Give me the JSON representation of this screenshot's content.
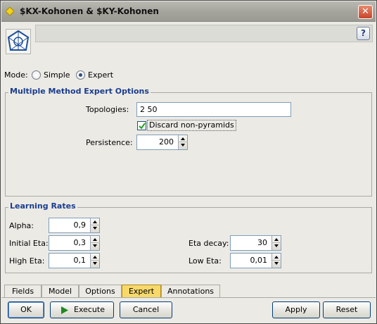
{
  "window": {
    "title": "$KX-Kohonen & $KY-Kohonen",
    "close_glyph": "✕"
  },
  "header": {
    "help_glyph": "?"
  },
  "mode": {
    "label": "Mode:",
    "options": [
      "Simple",
      "Expert"
    ],
    "selected": "Expert"
  },
  "mmeo": {
    "title": "Multiple Method Expert Options",
    "topologies_label": "Topologies:",
    "topologies_value": "2 50",
    "discard_label": "Discard non-pyramids",
    "discard_checked": true,
    "persistence_label": "Persistence:",
    "persistence_value": "200"
  },
  "learning": {
    "title": "Learning Rates",
    "alpha_label": "Alpha:",
    "alpha_value": "0,9",
    "initial_eta_label": "Initial Eta:",
    "initial_eta_value": "0,3",
    "high_eta_label": "High Eta:",
    "high_eta_value": "0,1",
    "eta_decay_label": "Eta decay:",
    "eta_decay_value": "30",
    "low_eta_label": "Low Eta:",
    "low_eta_value": "0,01"
  },
  "tabs": [
    "Fields",
    "Model",
    "Options",
    "Expert",
    "Annotations"
  ],
  "active_tab": "Expert",
  "buttons": {
    "ok": "OK",
    "execute": "Execute",
    "cancel": "Cancel",
    "apply": "Apply",
    "reset": "Reset"
  },
  "colors": {
    "accent": "#1a3d8f",
    "active_tab": "#f7d96a",
    "close": "#c8442a",
    "execute_icon": "#1f8a1f"
  }
}
